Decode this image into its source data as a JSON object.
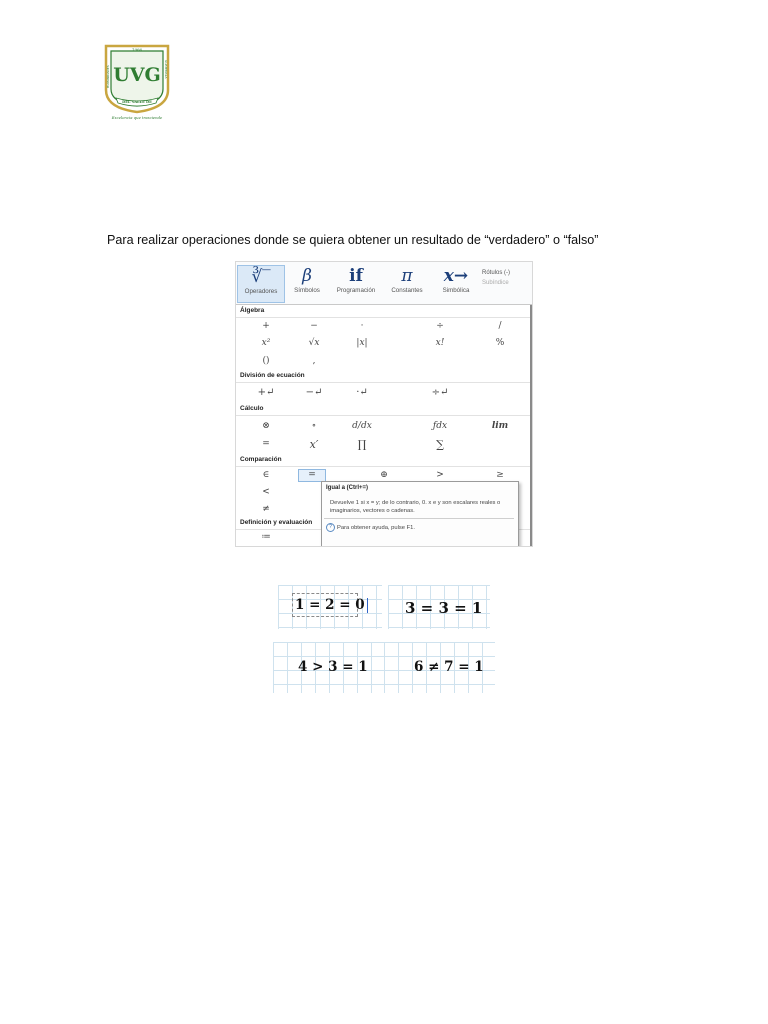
{
  "logo": {
    "top_text": "1966",
    "letters": "UVG",
    "ring_left": "HUMANIDADES",
    "ring_right": "GUATEMALA",
    "ribbon": "DEL VALLE DE",
    "motto": "Excelencia que trasciende",
    "colors": {
      "green": "#2f7d32",
      "gold": "#c9a640"
    }
  },
  "intro_text": "Para realizar operaciones donde se quiera obtener un resultado de “verdadero” o “falso”",
  "ribbon": {
    "items": [
      {
        "glyph": "∛‾",
        "label": "Operadores"
      },
      {
        "glyph": "β",
        "label": "Símbolos"
      },
      {
        "glyph": "if",
        "label": "Programación"
      },
      {
        "glyph": "π",
        "label": "Constantes"
      },
      {
        "glyph": "x→",
        "label": "Simbólica"
      }
    ],
    "side_top": "Rótulos (-)",
    "side_bottom": "Subíndice"
  },
  "menu": {
    "sections": [
      {
        "title": "Álgebra",
        "rows": [
          [
            "+",
            "−",
            "·",
            "÷",
            "/"
          ],
          [
            "x²",
            "√x",
            "|x|",
            "x!",
            "%"
          ],
          [
            "()",
            ","
          ]
        ]
      },
      {
        "title": "División de ecuación",
        "rows": [
          [
            "+↵",
            "−↵",
            "·↵",
            "÷↵"
          ]
        ]
      },
      {
        "title": "Cálculo",
        "rows": [
          [
            "⊗",
            "∘",
            "d/dx",
            "ƒdx",
            "lim"
          ],
          [
            "=",
            "x′",
            "∏",
            "∑"
          ]
        ]
      },
      {
        "title": "Comparación",
        "rows": [
          [
            "∈",
            "=",
            "⊕",
            ">",
            "≥"
          ],
          [
            "<"
          ],
          [
            "≠"
          ]
        ]
      },
      {
        "title": "Definición y evaluación",
        "rows": [
          [
            "≔",
            "=",
            "≡",
            "→"
          ]
        ]
      }
    ]
  },
  "tooltip": {
    "title": "Igual a (Ctrl+=)",
    "body": "Devuelve 1 si x = y; de lo contrario, 0. x e y son escalares reales o imaginarios, vectores o cadenas.",
    "help_icon": "?",
    "help": "Para obtener ayuda, pulse F1."
  },
  "equations": [
    {
      "text": "1 = 2 = 0"
    },
    {
      "text": "3 = 3 = 1"
    },
    {
      "text": "4 > 3 = 1"
    },
    {
      "text": "6 ≠ 7 = 1"
    }
  ]
}
